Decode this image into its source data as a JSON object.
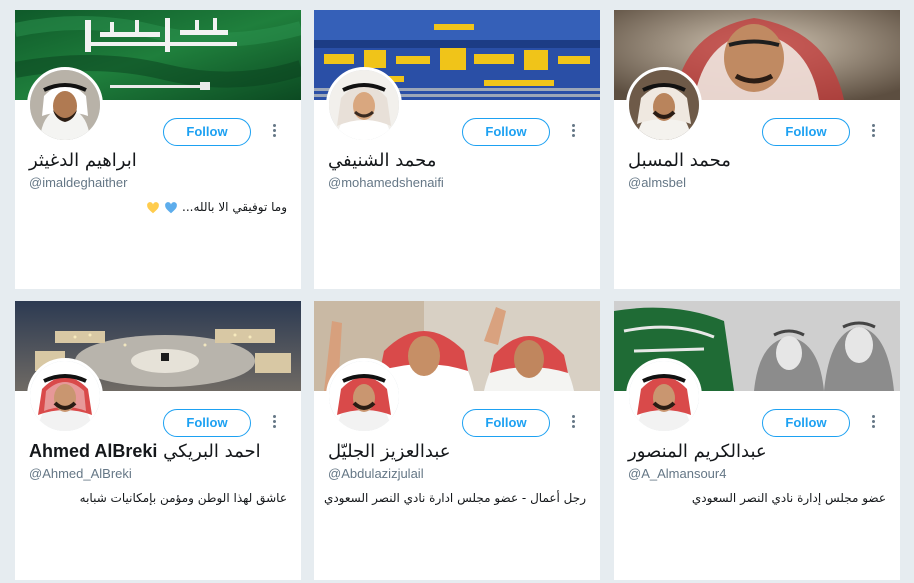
{
  "follow_label": "Follow",
  "accent_color": "#1da1f2",
  "cards": [
    {
      "name": "ابراهيم الدغيثر",
      "handle": "@imaldeghaither",
      "bio": "وما توفيقي الا بالله...",
      "bio_icons": [
        "yellow-heart-icon",
        "blue-heart-icon"
      ],
      "banner": "saudi-flag-banner"
    },
    {
      "name": "محمد الشنيفي",
      "handle": "@mohamedshenaifi",
      "bio": "",
      "banner": "stadium-crowd-banner"
    },
    {
      "name": "محمد المسبل",
      "handle": "@almsbel",
      "bio": "",
      "banner": "portrait-banner"
    },
    {
      "name_latin": "Ahmed AlBreki",
      "name": "احمد البريكي",
      "handle": "@Ahmed_AlBreki",
      "bio": "عاشق لهذا الوطن ومؤمن بإمكانيات شبابه",
      "banner": "aerial-mosque-banner"
    },
    {
      "name": "عبدالعزيز الجليّل",
      "handle": "@Abdulazizjulail",
      "bio": "رجل أعمال - عضو مجلس ادارة نادي النصر السعودي",
      "banner": "leaders-waving-banner"
    },
    {
      "name": "عبدالكريم المنصور",
      "handle": "@A_Almansour4",
      "bio": "عضو مجلس إدارة نادي النصر السعودي",
      "banner": "flag-and-leaders-banner"
    }
  ]
}
